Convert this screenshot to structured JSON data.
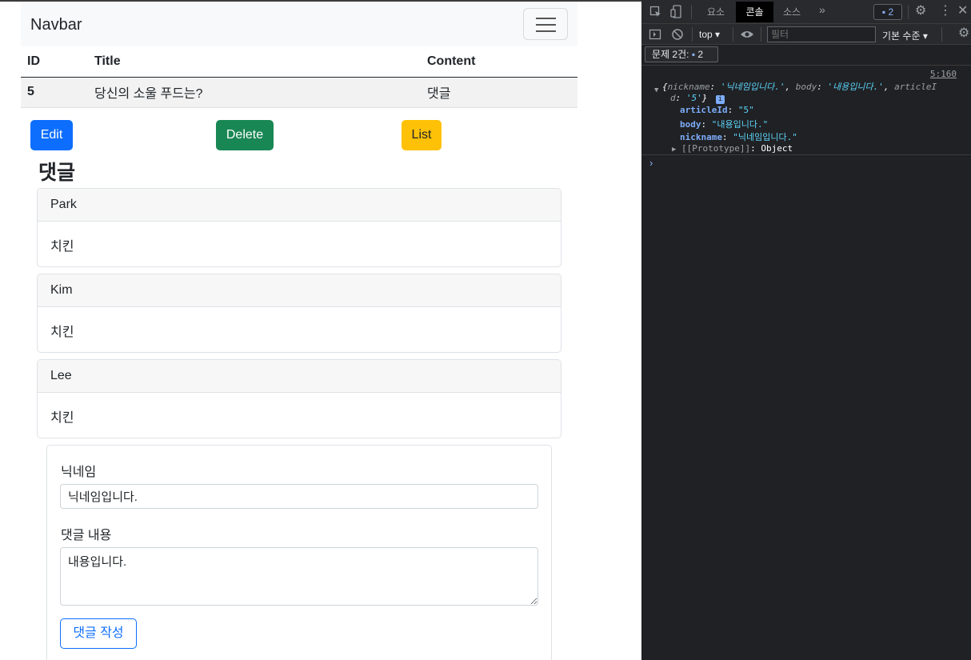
{
  "navbar": {
    "brand": "Navbar"
  },
  "article_table": {
    "headers": [
      "ID",
      "Title",
      "Content"
    ],
    "row": {
      "id": "5",
      "title": "당신의 소울 푸드는?",
      "content": "댓글"
    }
  },
  "actions": {
    "edit": "Edit",
    "delete": "Delete",
    "list": "List"
  },
  "comments": {
    "heading": "댓글",
    "items": [
      {
        "nickname": "Park",
        "body": "치킨"
      },
      {
        "nickname": "Kim",
        "body": "치킨"
      },
      {
        "nickname": "Lee",
        "body": "치킨"
      }
    ]
  },
  "comment_form": {
    "nickname_label": "닉네임",
    "nickname_value": "닉네임입니다.",
    "body_label": "댓글 내용",
    "body_value": "내용입니다.",
    "submit_label": "댓글 작성"
  },
  "devtools": {
    "tabs": {
      "elements": "요소",
      "console": "콘솔",
      "sources": "소스",
      "more": "»"
    },
    "issue_count": "2",
    "context": "top ▾",
    "filter_placeholder": "필터",
    "level": "기본 수준 ▾",
    "issues_label": "문제 2건:",
    "issues_count": "2",
    "log": {
      "source": "5:160",
      "summary_line1_prefix": "{",
      "summary_k1": "nickname",
      "summary_v1": "'닉네임입니다.'",
      "summary_k2": "body",
      "summary_v2": "'내용입니다.'",
      "summary_k3_part": "articleI",
      "summary_line2_k3_rest": "d",
      "summary_v3": "'5'",
      "props": [
        {
          "key": "articleId",
          "value": "\"5\""
        },
        {
          "key": "body",
          "value": "\"내용입니다.\""
        },
        {
          "key": "nickname",
          "value": "\"닉네임입니다.\""
        }
      ],
      "prototype_key": "[[Prototype]]",
      "prototype_value": "Object"
    },
    "prompt": "›"
  },
  "colors": {
    "primary": "#0d6efd",
    "success": "#198754",
    "warning": "#ffc107",
    "devtools_bg": "#202124"
  }
}
